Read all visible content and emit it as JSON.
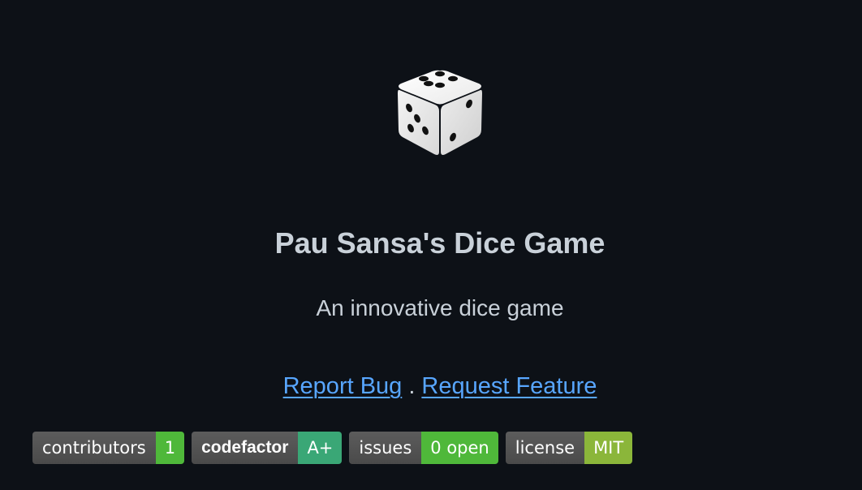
{
  "project": {
    "logo_icon": "dice-icon",
    "title": "Pau Sansa's Dice Game",
    "subtitle": "An innovative dice game"
  },
  "links": {
    "report_bug": "Report Bug",
    "separator": ".",
    "request_feature": "Request Feature"
  },
  "badges": [
    {
      "label": "contributors",
      "value": "1",
      "color": "#4fb83a"
    },
    {
      "label": "codefactor",
      "value": "A+",
      "color": "#3aa776"
    },
    {
      "label": "issues",
      "value": "0 open",
      "color": "#4fb83a"
    },
    {
      "label": "license",
      "value": "MIT",
      "color": "#8bb63a"
    }
  ],
  "colors": {
    "background": "#0d1117",
    "text": "#c9d1d9",
    "link": "#58a6ff",
    "badge_label_bg": "#555555"
  }
}
